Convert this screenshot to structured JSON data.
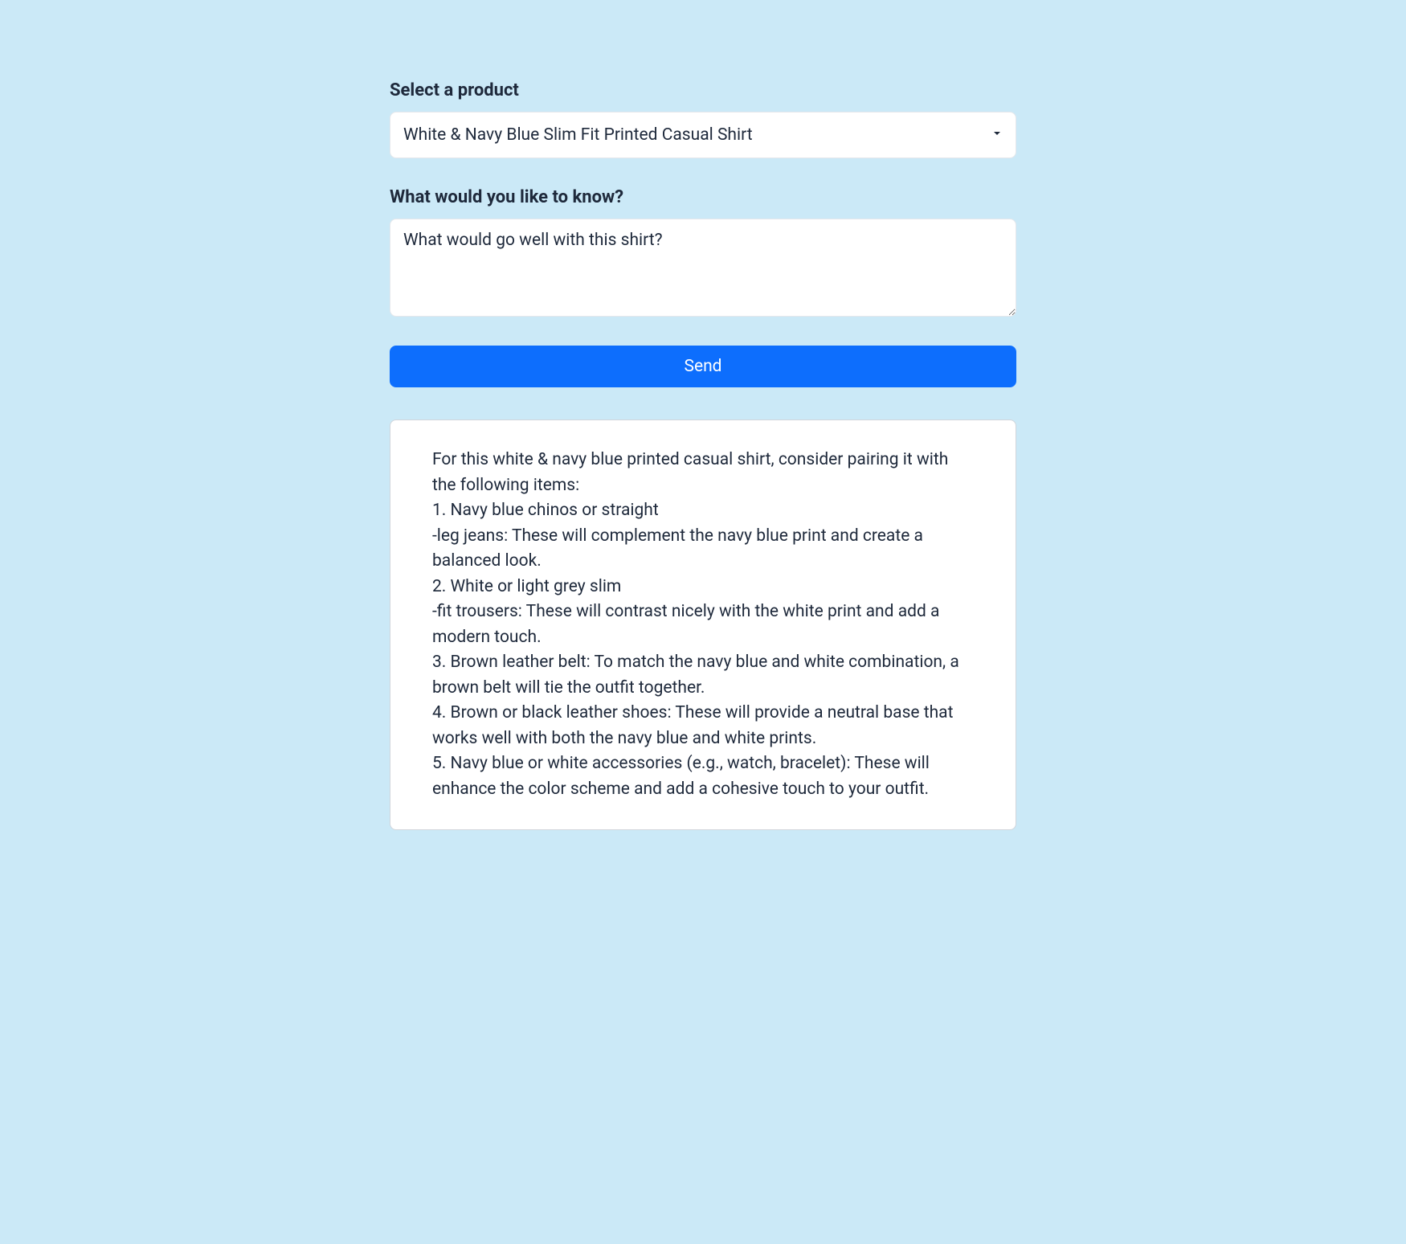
{
  "form": {
    "product_label": "Select a product",
    "product_selected": "White & Navy Blue Slim Fit Printed Casual Shirt",
    "question_label": "What would you like to know?",
    "question_value": "What would go well with this shirt?",
    "send_label": "Send"
  },
  "response": {
    "text": "For this white & navy blue printed casual shirt, consider pairing it with the following items:\n1. Navy blue chinos or straight\n-leg jeans: These will complement the navy blue print and create a balanced look.\n2. White or light grey slim\n-fit trousers: These will contrast nicely with the white print and add a modern touch.\n3. Brown leather belt: To match the navy blue and white combination, a brown belt will tie the outfit together.\n4. Brown or black leather shoes: These will provide a neutral base that works well with both the navy blue and white prints.\n5. Navy blue or white accessories (e.g., watch, bracelet): These will enhance the color scheme and add a cohesive touch to your outfit."
  }
}
